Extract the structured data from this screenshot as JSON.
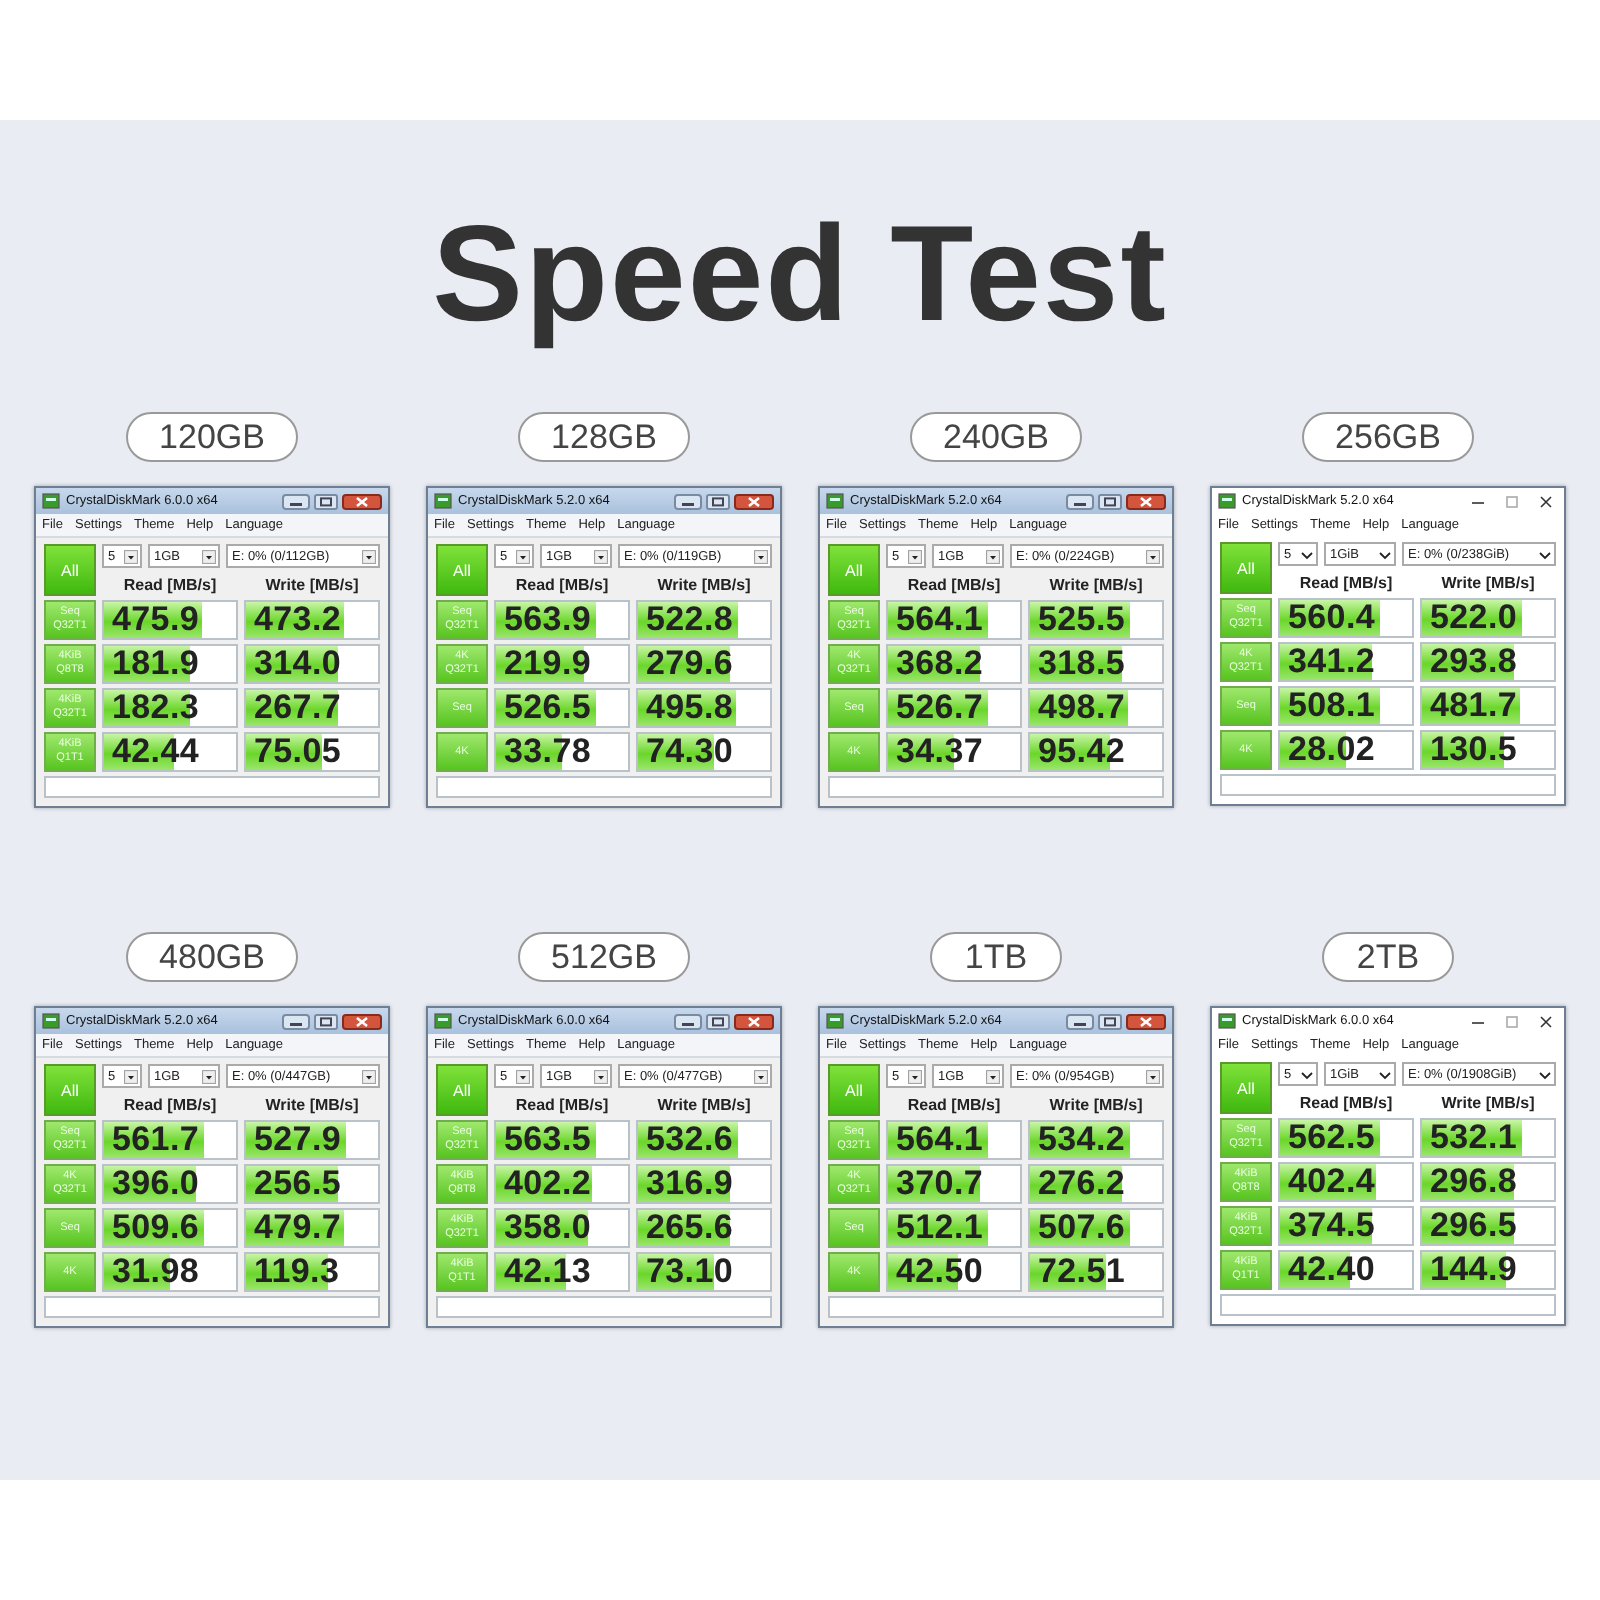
{
  "title": "Speed Test",
  "panels": [
    {
      "label": "120GB",
      "window": {
        "kind": "win7",
        "title": "CrystalDiskMark 6.0.0 x64",
        "menu": [
          "File",
          "Settings",
          "Theme",
          "Help",
          "Language"
        ],
        "count": "5",
        "size": "1GB",
        "drive": "E: 0% (0/112GB)",
        "all": "All",
        "headers": [
          "Read [MB/s]",
          "Write [MB/s]"
        ],
        "rows": [
          {
            "test": [
              "Seq",
              "Q32T1"
            ],
            "read": {
              "value": "475.9",
              "level": 0.74
            },
            "write": {
              "value": "473.2",
              "level": 0.74
            }
          },
          {
            "test": [
              "4KiB",
              "Q8T8"
            ],
            "read": {
              "value": "181.9",
              "level": 0.65
            },
            "write": {
              "value": "314.0",
              "level": 0.7
            }
          },
          {
            "test": [
              "4KiB",
              "Q32T1"
            ],
            "read": {
              "value": "182.3",
              "level": 0.65
            },
            "write": {
              "value": "267.7",
              "level": 0.69
            }
          },
          {
            "test": [
              "4KiB",
              "Q1T1"
            ],
            "read": {
              "value": "42.44",
              "level": 0.53
            },
            "write": {
              "value": "75.05",
              "level": 0.57
            }
          }
        ]
      }
    },
    {
      "label": "128GB",
      "window": {
        "kind": "win7",
        "title": "CrystalDiskMark 5.2.0 x64",
        "menu": [
          "File",
          "Settings",
          "Theme",
          "Help",
          "Language"
        ],
        "count": "5",
        "size": "1GB",
        "drive": "E: 0% (0/119GB)",
        "all": "All",
        "headers": [
          "Read [MB/s]",
          "Write [MB/s]"
        ],
        "rows": [
          {
            "test": [
              "Seq",
              "Q32T1"
            ],
            "read": {
              "value": "563.9",
              "level": 0.75
            },
            "write": {
              "value": "522.8",
              "level": 0.75
            }
          },
          {
            "test": [
              "4K",
              "Q32T1"
            ],
            "read": {
              "value": "219.9",
              "level": 0.67
            },
            "write": {
              "value": "279.6",
              "level": 0.69
            }
          },
          {
            "test": [
              "Seq"
            ],
            "read": {
              "value": "526.5",
              "level": 0.75
            },
            "write": {
              "value": "495.8",
              "level": 0.74
            }
          },
          {
            "test": [
              "4K"
            ],
            "read": {
              "value": "33.78",
              "level": 0.5
            },
            "write": {
              "value": "74.30",
              "level": 0.57
            }
          }
        ]
      }
    },
    {
      "label": "240GB",
      "window": {
        "kind": "win7",
        "title": "CrystalDiskMark 5.2.0 x64",
        "menu": [
          "File",
          "Settings",
          "Theme",
          "Help",
          "Language"
        ],
        "count": "5",
        "size": "1GB",
        "drive": "E: 0% (0/224GB)",
        "all": "All",
        "headers": [
          "Read [MB/s]",
          "Write [MB/s]"
        ],
        "rows": [
          {
            "test": [
              "Seq",
              "Q32T1"
            ],
            "read": {
              "value": "564.1",
              "level": 0.75
            },
            "write": {
              "value": "525.5",
              "level": 0.75
            }
          },
          {
            "test": [
              "4K",
              "Q32T1"
            ],
            "read": {
              "value": "368.2",
              "level": 0.7
            },
            "write": {
              "value": "318.5",
              "level": 0.7
            }
          },
          {
            "test": [
              "Seq"
            ],
            "read": {
              "value": "526.7",
              "level": 0.75
            },
            "write": {
              "value": "498.7",
              "level": 0.74
            }
          },
          {
            "test": [
              "4K"
            ],
            "read": {
              "value": "34.37",
              "level": 0.5
            },
            "write": {
              "value": "95.42",
              "level": 0.6
            }
          }
        ]
      }
    },
    {
      "label": "256GB",
      "window": {
        "kind": "win10",
        "title": "CrystalDiskMark 5.2.0 x64",
        "menu": [
          "File",
          "Settings",
          "Theme",
          "Help",
          "Language"
        ],
        "count": "5",
        "size": "1GiB",
        "drive": "E: 0% (0/238GiB)",
        "all": "All",
        "headers": [
          "Read [MB/s]",
          "Write [MB/s]"
        ],
        "rows": [
          {
            "test": [
              "Seq",
              "Q32T1"
            ],
            "read": {
              "value": "560.4",
              "level": 0.75
            },
            "write": {
              "value": "522.0",
              "level": 0.75
            }
          },
          {
            "test": [
              "4K",
              "Q32T1"
            ],
            "read": {
              "value": "341.2",
              "level": 0.7
            },
            "write": {
              "value": "293.8",
              "level": 0.69
            }
          },
          {
            "test": [
              "Seq"
            ],
            "read": {
              "value": "508.1",
              "level": 0.75
            },
            "write": {
              "value": "481.7",
              "level": 0.74
            }
          },
          {
            "test": [
              "4K"
            ],
            "read": {
              "value": "28.02",
              "level": 0.5
            },
            "write": {
              "value": "130.5",
              "level": 0.62
            }
          }
        ]
      }
    },
    {
      "label": "480GB",
      "window": {
        "kind": "win7",
        "title": "CrystalDiskMark 5.2.0 x64",
        "menu": [
          "File",
          "Settings",
          "Theme",
          "Help",
          "Language"
        ],
        "count": "5",
        "size": "1GB",
        "drive": "E: 0% (0/447GB)",
        "all": "All",
        "headers": [
          "Read [MB/s]",
          "Write [MB/s]"
        ],
        "rows": [
          {
            "test": [
              "Seq",
              "Q32T1"
            ],
            "read": {
              "value": "561.7",
              "level": 0.75
            },
            "write": {
              "value": "527.9",
              "level": 0.75
            }
          },
          {
            "test": [
              "4K",
              "Q32T1"
            ],
            "read": {
              "value": "396.0",
              "level": 0.7
            },
            "write": {
              "value": "256.5",
              "level": 0.69
            }
          },
          {
            "test": [
              "Seq"
            ],
            "read": {
              "value": "509.6",
              "level": 0.75
            },
            "write": {
              "value": "479.7",
              "level": 0.74
            }
          },
          {
            "test": [
              "4K"
            ],
            "read": {
              "value": "31.98",
              "level": 0.5
            },
            "write": {
              "value": "119.3",
              "level": 0.62
            }
          }
        ]
      }
    },
    {
      "label": "512GB",
      "window": {
        "kind": "win7",
        "title": "CrystalDiskMark 6.0.0 x64",
        "menu": [
          "File",
          "Settings",
          "Theme",
          "Help",
          "Language"
        ],
        "count": "5",
        "size": "1GB",
        "drive": "E: 0% (0/477GB)",
        "all": "All",
        "headers": [
          "Read [MB/s]",
          "Write [MB/s]"
        ],
        "rows": [
          {
            "test": [
              "Seq",
              "Q32T1"
            ],
            "read": {
              "value": "563.5",
              "level": 0.75
            },
            "write": {
              "value": "532.6",
              "level": 0.75
            }
          },
          {
            "test": [
              "4KiB",
              "Q8T8"
            ],
            "read": {
              "value": "402.2",
              "level": 0.73
            },
            "write": {
              "value": "316.9",
              "level": 0.7
            }
          },
          {
            "test": [
              "4KiB",
              "Q32T1"
            ],
            "read": {
              "value": "358.0",
              "level": 0.7
            },
            "write": {
              "value": "265.6",
              "level": 0.69
            }
          },
          {
            "test": [
              "4KiB",
              "Q1T1"
            ],
            "read": {
              "value": "42.13",
              "level": 0.53
            },
            "write": {
              "value": "73.10",
              "level": 0.57
            }
          }
        ]
      }
    },
    {
      "label": "1TB",
      "window": {
        "kind": "win7",
        "title": "CrystalDiskMark 5.2.0 x64",
        "menu": [
          "File",
          "Settings",
          "Theme",
          "Help",
          "Language"
        ],
        "count": "5",
        "size": "1GB",
        "drive": "E: 0% (0/954GB)",
        "all": "All",
        "headers": [
          "Read [MB/s]",
          "Write [MB/s]"
        ],
        "rows": [
          {
            "test": [
              "Seq",
              "Q32T1"
            ],
            "read": {
              "value": "564.1",
              "level": 0.75
            },
            "write": {
              "value": "534.2",
              "level": 0.75
            }
          },
          {
            "test": [
              "4K",
              "Q32T1"
            ],
            "read": {
              "value": "370.7",
              "level": 0.7
            },
            "write": {
              "value": "276.2",
              "level": 0.69
            }
          },
          {
            "test": [
              "Seq"
            ],
            "read": {
              "value": "512.1",
              "level": 0.75
            },
            "write": {
              "value": "507.6",
              "level": 0.75
            }
          },
          {
            "test": [
              "4K"
            ],
            "read": {
              "value": "42.50",
              "level": 0.53
            },
            "write": {
              "value": "72.51",
              "level": 0.57
            }
          }
        ]
      }
    },
    {
      "label": "2TB",
      "window": {
        "kind": "win10",
        "title": "CrystalDiskMark 6.0.0 x64",
        "menu": [
          "File",
          "Settings",
          "Theme",
          "Help",
          "Language"
        ],
        "count": "5",
        "size": "1GiB",
        "drive": "E: 0% (0/1908GiB)",
        "all": "All",
        "headers": [
          "Read [MB/s]",
          "Write [MB/s]"
        ],
        "rows": [
          {
            "test": [
              "Seq",
              "Q32T1"
            ],
            "read": {
              "value": "562.5",
              "level": 0.75
            },
            "write": {
              "value": "532.1",
              "level": 0.75
            }
          },
          {
            "test": [
              "4KiB",
              "Q8T8"
            ],
            "read": {
              "value": "402.4",
              "level": 0.73
            },
            "write": {
              "value": "296.8",
              "level": 0.69
            }
          },
          {
            "test": [
              "4KiB",
              "Q32T1"
            ],
            "read": {
              "value": "374.5",
              "level": 0.7
            },
            "write": {
              "value": "296.5",
              "level": 0.69
            }
          },
          {
            "test": [
              "4KiB",
              "Q1T1"
            ],
            "read": {
              "value": "42.40",
              "level": 0.53
            },
            "write": {
              "value": "144.9",
              "level": 0.63
            }
          }
        ]
      }
    }
  ]
}
